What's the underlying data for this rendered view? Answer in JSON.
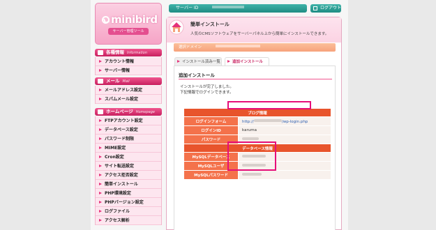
{
  "logo": {
    "name": "minibird",
    "subtitle": "サーバー管理ツール"
  },
  "sidebar": {
    "sections": [
      {
        "label": "各種情報",
        "en": "Information",
        "items": [
          "アカウント情報",
          "サーバー情報"
        ]
      },
      {
        "label": "メール",
        "en": "Mail",
        "items": [
          "メールアドレス設定",
          "スパムメール設定"
        ]
      },
      {
        "label": "ホームページ",
        "en": "Homepage",
        "items": [
          "FTPアカウント設定",
          "データベース設定",
          "パスワード制限",
          "MIME設定",
          "Cron設定",
          "サイト転送設定",
          "アクセス拒否設定",
          "簡単インストール",
          "PHP環境設定",
          "PHPバージョン設定",
          "ログファイル",
          "アクセス解析"
        ]
      }
    ]
  },
  "topbar": {
    "server_id_label": "サーバー ID",
    "logout_label": "ログアウト"
  },
  "panel": {
    "title": "簡単インストール",
    "description": "人気のCMSソフトウェアをサーバーパネル上から簡単にインストールできます。",
    "domain_label": "選択ドメイン",
    "tabs": [
      "インストール済み一覧",
      "追加インストール"
    ],
    "active_tab": 1,
    "section_title": "追加インストール",
    "messages": [
      "インストールが完了しました。",
      "下記情報でログインできます。"
    ]
  },
  "blog_table": {
    "header": "ブログ情報",
    "rows": [
      {
        "key": "ログインフォーム",
        "value": "http://",
        "value_suffix": "/wp-login.php"
      },
      {
        "key": "ログインID",
        "value": "karuma"
      },
      {
        "key": "パスワード",
        "value": ""
      }
    ]
  },
  "db_table": {
    "header": "データベース情報",
    "rows": [
      {
        "key": "MySQLデータベース",
        "value": ""
      },
      {
        "key": "MySQLユーザ",
        "value": ""
      },
      {
        "key": "MySQLパスワード",
        "value": ""
      }
    ]
  },
  "colors": {
    "accent": "#e5327a",
    "teal": "#1f8c83",
    "table_header": "#e8542c",
    "highlight": "#e60e79"
  }
}
